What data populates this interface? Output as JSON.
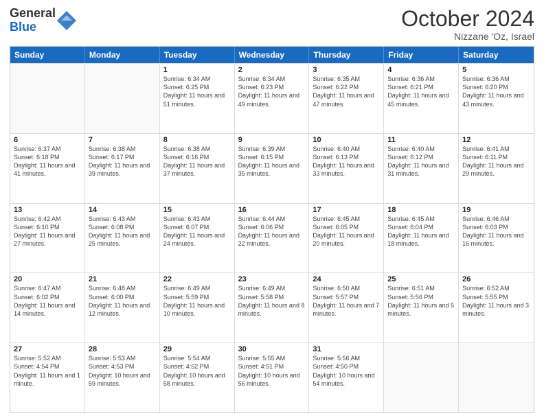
{
  "header": {
    "logo_general": "General",
    "logo_blue": "Blue",
    "month_title": "October 2024",
    "location": "Nizzane 'Oz, Israel"
  },
  "weekdays": [
    "Sunday",
    "Monday",
    "Tuesday",
    "Wednesday",
    "Thursday",
    "Friday",
    "Saturday"
  ],
  "rows": [
    [
      {
        "day": "",
        "info": ""
      },
      {
        "day": "",
        "info": ""
      },
      {
        "day": "1",
        "info": "Sunrise: 6:34 AM\nSunset: 6:25 PM\nDaylight: 11 hours and 51 minutes."
      },
      {
        "day": "2",
        "info": "Sunrise: 6:34 AM\nSunset: 6:23 PM\nDaylight: 11 hours and 49 minutes."
      },
      {
        "day": "3",
        "info": "Sunrise: 6:35 AM\nSunset: 6:22 PM\nDaylight: 11 hours and 47 minutes."
      },
      {
        "day": "4",
        "info": "Sunrise: 6:36 AM\nSunset: 6:21 PM\nDaylight: 11 hours and 45 minutes."
      },
      {
        "day": "5",
        "info": "Sunrise: 6:36 AM\nSunset: 6:20 PM\nDaylight: 11 hours and 43 minutes."
      }
    ],
    [
      {
        "day": "6",
        "info": "Sunrise: 6:37 AM\nSunset: 6:18 PM\nDaylight: 11 hours and 41 minutes."
      },
      {
        "day": "7",
        "info": "Sunrise: 6:38 AM\nSunset: 6:17 PM\nDaylight: 11 hours and 39 minutes."
      },
      {
        "day": "8",
        "info": "Sunrise: 6:38 AM\nSunset: 6:16 PM\nDaylight: 11 hours and 37 minutes."
      },
      {
        "day": "9",
        "info": "Sunrise: 6:39 AM\nSunset: 6:15 PM\nDaylight: 11 hours and 35 minutes."
      },
      {
        "day": "10",
        "info": "Sunrise: 6:40 AM\nSunset: 6:13 PM\nDaylight: 11 hours and 33 minutes."
      },
      {
        "day": "11",
        "info": "Sunrise: 6:40 AM\nSunset: 6:12 PM\nDaylight: 11 hours and 31 minutes."
      },
      {
        "day": "12",
        "info": "Sunrise: 6:41 AM\nSunset: 6:11 PM\nDaylight: 11 hours and 29 minutes."
      }
    ],
    [
      {
        "day": "13",
        "info": "Sunrise: 6:42 AM\nSunset: 6:10 PM\nDaylight: 11 hours and 27 minutes."
      },
      {
        "day": "14",
        "info": "Sunrise: 6:43 AM\nSunset: 6:08 PM\nDaylight: 11 hours and 25 minutes."
      },
      {
        "day": "15",
        "info": "Sunrise: 6:43 AM\nSunset: 6:07 PM\nDaylight: 11 hours and 24 minutes."
      },
      {
        "day": "16",
        "info": "Sunrise: 6:44 AM\nSunset: 6:06 PM\nDaylight: 11 hours and 22 minutes."
      },
      {
        "day": "17",
        "info": "Sunrise: 6:45 AM\nSunset: 6:05 PM\nDaylight: 11 hours and 20 minutes."
      },
      {
        "day": "18",
        "info": "Sunrise: 6:45 AM\nSunset: 6:04 PM\nDaylight: 11 hours and 18 minutes."
      },
      {
        "day": "19",
        "info": "Sunrise: 6:46 AM\nSunset: 6:03 PM\nDaylight: 11 hours and 16 minutes."
      }
    ],
    [
      {
        "day": "20",
        "info": "Sunrise: 6:47 AM\nSunset: 6:02 PM\nDaylight: 11 hours and 14 minutes."
      },
      {
        "day": "21",
        "info": "Sunrise: 6:48 AM\nSunset: 6:00 PM\nDaylight: 11 hours and 12 minutes."
      },
      {
        "day": "22",
        "info": "Sunrise: 6:49 AM\nSunset: 5:59 PM\nDaylight: 11 hours and 10 minutes."
      },
      {
        "day": "23",
        "info": "Sunrise: 6:49 AM\nSunset: 5:58 PM\nDaylight: 11 hours and 8 minutes."
      },
      {
        "day": "24",
        "info": "Sunrise: 6:50 AM\nSunset: 5:57 PM\nDaylight: 11 hours and 7 minutes."
      },
      {
        "day": "25",
        "info": "Sunrise: 6:51 AM\nSunset: 5:56 PM\nDaylight: 11 hours and 5 minutes."
      },
      {
        "day": "26",
        "info": "Sunrise: 6:52 AM\nSunset: 5:55 PM\nDaylight: 11 hours and 3 minutes."
      }
    ],
    [
      {
        "day": "27",
        "info": "Sunrise: 5:52 AM\nSunset: 4:54 PM\nDaylight: 11 hours and 1 minute."
      },
      {
        "day": "28",
        "info": "Sunrise: 5:53 AM\nSunset: 4:53 PM\nDaylight: 10 hours and 59 minutes."
      },
      {
        "day": "29",
        "info": "Sunrise: 5:54 AM\nSunset: 4:52 PM\nDaylight: 10 hours and 58 minutes."
      },
      {
        "day": "30",
        "info": "Sunrise: 5:55 AM\nSunset: 4:51 PM\nDaylight: 10 hours and 56 minutes."
      },
      {
        "day": "31",
        "info": "Sunrise: 5:56 AM\nSunset: 4:50 PM\nDaylight: 10 hours and 54 minutes."
      },
      {
        "day": "",
        "info": ""
      },
      {
        "day": "",
        "info": ""
      }
    ]
  ]
}
